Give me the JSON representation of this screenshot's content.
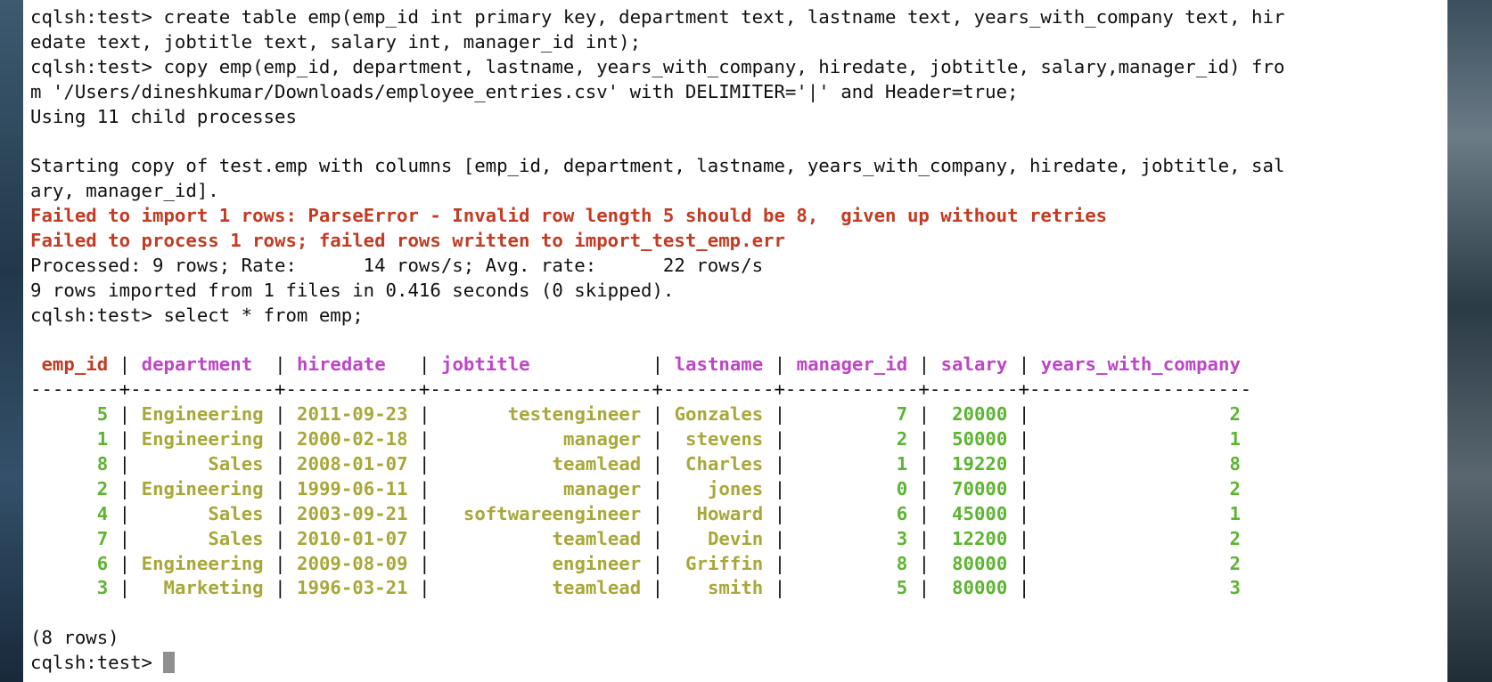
{
  "terminal": {
    "prompt": "cqlsh:test> ",
    "bracket_open": "[",
    "bracket_close": "]",
    "lines": [
      "cqlsh:test> create table emp(emp_id int primary key, department text, lastname text, years_with_company text, hir",
      "edate text, jobtitle text, salary int, manager_id int);",
      "cqlsh:test> copy emp(emp_id, department, lastname, years_with_company, hiredate, jobtitle, salary,manager_id) fro",
      "m '/Users/dineshkumar/Downloads/employee_entries.csv' with DELIMITER='|' and Header=true;",
      "Using 11 child processes",
      "",
      "Starting copy of test.emp with columns [emp_id, department, lastname, years_with_company, hiredate, jobtitle, sal",
      "ary, manager_id]."
    ],
    "errors": [
      "Failed to import 1 rows: ParseError - Invalid row length 5 should be 8,  given up without retries",
      "Failed to process 1 rows; failed rows written to import_test_emp.err"
    ],
    "processed_line": "Processed: 9 rows; Rate:      14 rows/s; Avg. rate:      22 rows/s",
    "imported_line": "9 rows imported from 1 files in 0.416 seconds (0 skipped).",
    "select_line": "cqlsh:test> select * from emp;",
    "divider": "--------+-------------+------------+--------------------+----------+------------+--------+--------------------",
    "rows_count": "(8 rows)",
    "final_prompt": "cqlsh:test> "
  },
  "table": {
    "columns": [
      "emp_id",
      "department",
      "hiredate",
      "jobtitle",
      "lastname",
      "manager_id",
      "salary",
      "years_with_company"
    ],
    "rows": [
      [
        "5",
        "Engineering",
        "2011-09-23",
        "testengineer",
        "Gonzales",
        "7",
        "20000",
        "2"
      ],
      [
        "1",
        "Engineering",
        "2000-02-18",
        "manager",
        "stevens",
        "2",
        "50000",
        "1"
      ],
      [
        "8",
        "Sales",
        "2008-01-07",
        "teamlead",
        "Charles",
        "1",
        "19220",
        "8"
      ],
      [
        "2",
        "Engineering",
        "1999-06-11",
        "manager",
        "jones",
        "0",
        "70000",
        "2"
      ],
      [
        "4",
        "Sales",
        "2003-09-21",
        "softwareengineer",
        "Howard",
        "6",
        "45000",
        "1"
      ],
      [
        "7",
        "Sales",
        "2010-01-07",
        "teamlead",
        "Devin",
        "3",
        "12200",
        "2"
      ],
      [
        "6",
        "Engineering",
        "2009-08-09",
        "engineer",
        "Griffin",
        "8",
        "80000",
        "2"
      ],
      [
        "3",
        "Marketing",
        "1996-03-21",
        "teamlead",
        "smith",
        "5",
        "80000",
        "3"
      ]
    ]
  },
  "colors": {
    "error": "#c23b22",
    "header": "#c044c8",
    "number": "#5cb531",
    "text": "#a8a83a"
  }
}
